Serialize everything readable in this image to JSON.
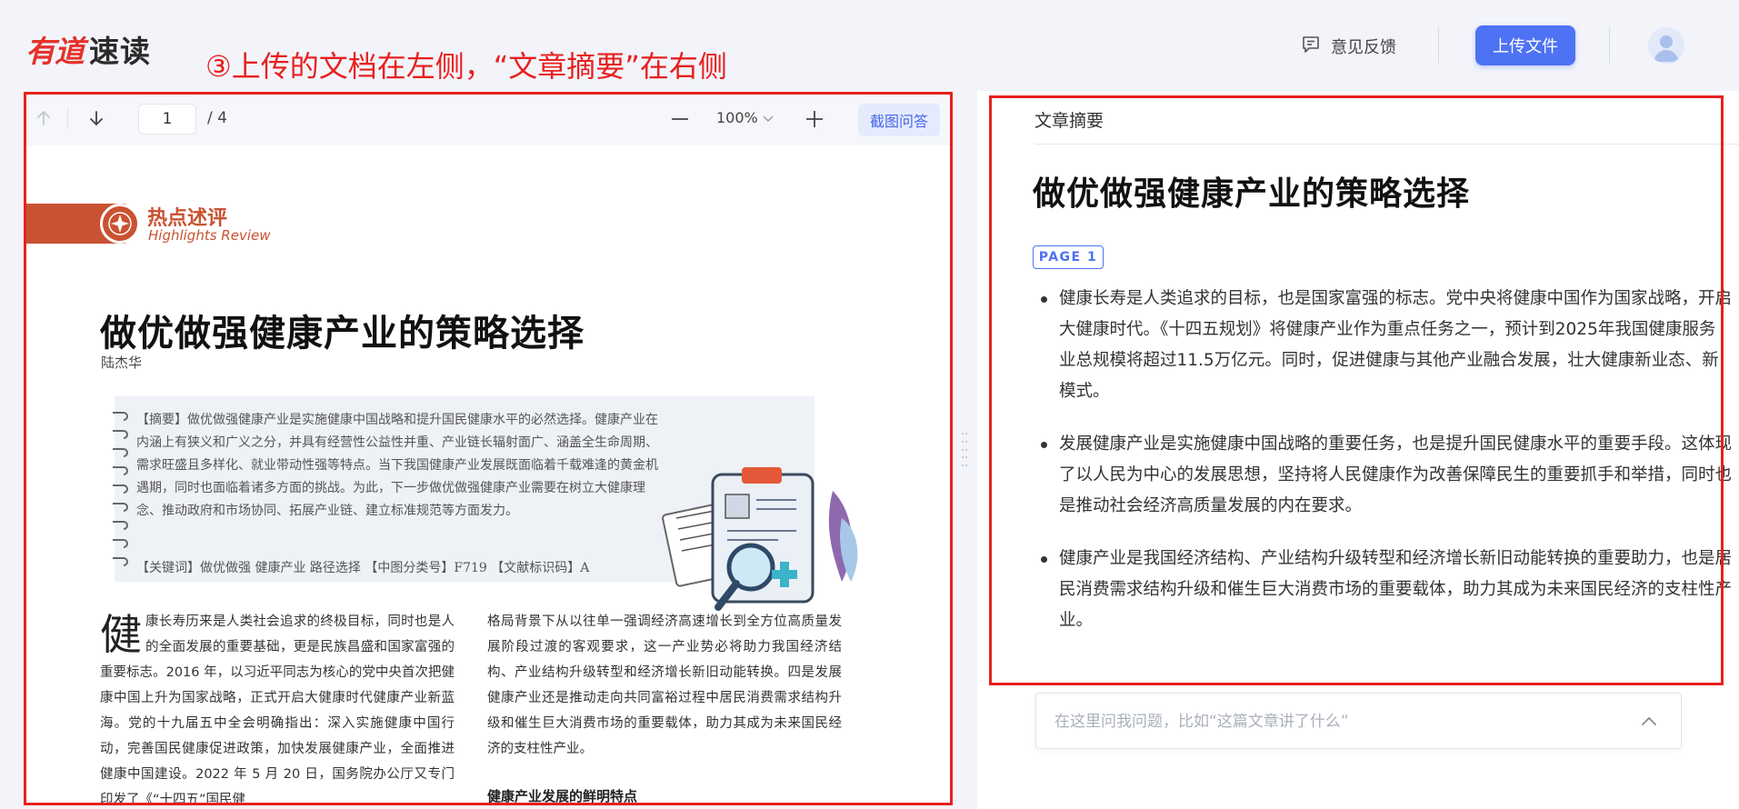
{
  "header": {
    "logo_brand": "有道",
    "logo_product": "速读",
    "annotation": "③上传的文档在左侧，“文章摘要”在右侧",
    "feedback_label": "意见反馈",
    "upload_label": "上传文件"
  },
  "doc_viewer": {
    "page_current": "1",
    "page_total": "/ 4",
    "zoom_level": "100%",
    "crop_qa_label": "截图问答",
    "page": {
      "banner_title": "热点述评",
      "banner_subtitle": "Highlights Review",
      "title": "做优做强健康产业的策略选择",
      "author": "陆杰华",
      "abstract": "【摘要】做优做强健康产业是实施健康中国战略和提升国民健康水平的必然选择。健康产业在内涵上有狭义和广义之分，并具有经营性公益性并重、产业链长辐射面广、涵盖全生命周期、需求旺盛且多样化、就业带动性强等特点。当下我国健康产业发展既面临着千载难逢的黄金机遇期，同时也面临着诸多方面的挑战。为此，下一步做优做强健康产业需要在树立大健康理念、推动政府和市场协同、拓展产业链、建立标准规范等方面发力。",
      "keywords": "【关键词】做优做强  健康产业  路径选择  【中图分类号】F719  【文献标识码】A",
      "dropcap": "健",
      "col_left": "康长寿历来是人类社会追求的终极目标，同时也是人的全面发展的重要基础，更是民族昌盛和国家富强的重要标志。2016 年，以习近平同志为核心的党中央首次把健康中国上升为国家战略，正式开启大健康时代健康产业新蓝海。党的十九届五中全会明确指出：深入实施健康中国行动，完善国民健康促进政策，加快发展健康产业，全面推进健康中国建设。2022 年 5 月 20 日，国务院办公厅又专门印发了《“十四五”国民健",
      "col_right": "格局背景下从以往单一强调经济高速增长到全方位高质量发展阶段过渡的客观要求，这一产业势必将助力我国经济结构、产业结构升级转型和经济增长新旧动能转换。四是发展健康产业还是推动走向共同富裕过程中居民消费需求结构升级和催生巨大消费市场的重要载体，助力其成为未来国民经济的支柱性产业。",
      "col_right_heading": "健康产业发展的鲜明特点"
    }
  },
  "summary": {
    "label": "文章摘要",
    "title": "做优做强健康产业的策略选择",
    "page_badge": "PAGE 1",
    "bullets": [
      "健康长寿是人类追求的目标，也是国家富强的标志。党中央将健康中国作为国家战略，开启大健康时代。《十四五规划》将健康产业作为重点任务之一，预计到2025年我国健康服务业总规模将超过11.5万亿元。同时，促进健康与其他产业融合发展，壮大健康新业态、新模式。",
      "发展健康产业是实施健康中国战略的重要任务，也是提升国民健康水平的重要手段。这体现了以人民为中心的发展思想，坚持将人民健康作为改善保障民生的重要抓手和举措，同时也是推动社会经济高质量发展的内在要求。",
      "健康产业是我国经济结构、产业结构升级转型和经济增长新旧动能转换的重要助力，也是居民消费需求结构升级和催生巨大消费市场的重要载体，助力其成为未来国民经济的支柱性产业。"
    ],
    "ask_placeholder": "在这里问我问题，比如“这篇文章讲了什么”"
  },
  "colors": {
    "brand_red": "#e4322b",
    "annotation_red": "#e8201f",
    "primary_blue": "#4d72f3",
    "banner_orange": "#c95232"
  },
  "icons": [
    "feedback-icon",
    "user-avatar-icon",
    "arrow-up-icon",
    "arrow-down-icon",
    "zoom-out-icon",
    "zoom-in-icon",
    "chevron-down-icon",
    "chevron-up-icon",
    "drag-handle-icon"
  ]
}
